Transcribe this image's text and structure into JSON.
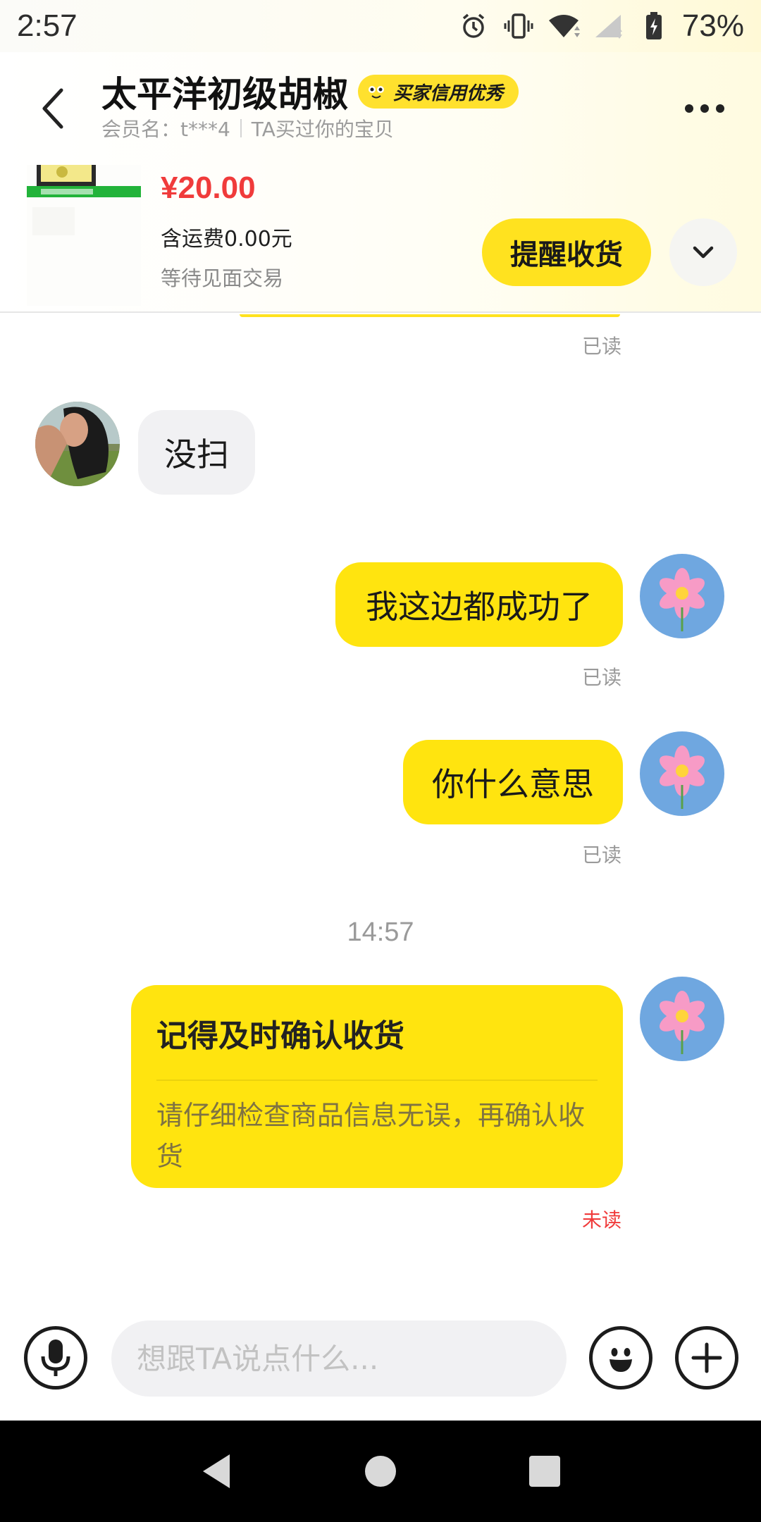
{
  "status_bar": {
    "time": "2:57",
    "battery": "73%",
    "icons": [
      "alarm-icon",
      "vibrate-icon",
      "wifi-icon",
      "signal-icon",
      "battery-icon"
    ]
  },
  "header": {
    "title": "太平洋初级胡椒",
    "credit_badge": "买家信用优秀",
    "member_name": "会员名：t***4",
    "bought_before": "TA买过你的宝贝",
    "price": "¥20.00",
    "shipping": "含运费0.00元",
    "order_status": "等待见面交易",
    "remind_button": "提醒收货"
  },
  "messages": [
    {
      "from": "me",
      "status": "已读"
    },
    {
      "from": "other",
      "text": "没扫"
    },
    {
      "from": "me",
      "text": "我这边都成功了",
      "status": "已读"
    },
    {
      "from": "me",
      "text": "你什么意思",
      "status": "已读"
    }
  ],
  "time_divider": "14:57",
  "card": {
    "title": "记得及时确认收货",
    "body": "请仔细检查商品信息无误，再确认收货",
    "status": "未读"
  },
  "input": {
    "placeholder": "想跟TA说点什么..."
  },
  "colors": {
    "accent_yellow": "#ffe40f",
    "price_red": "#f03b3b",
    "unread_red": "#f03b3b"
  }
}
